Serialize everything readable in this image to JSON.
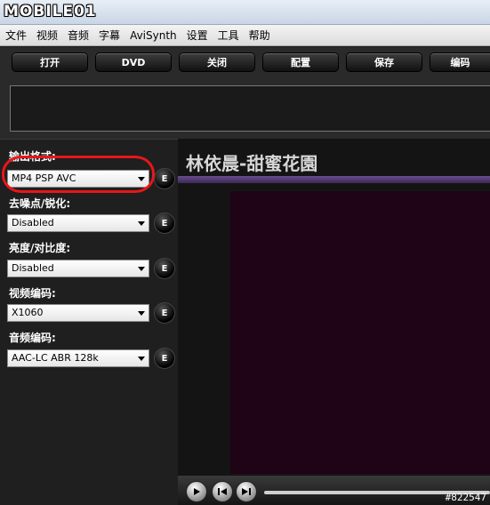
{
  "window": {
    "logo_text": "MOBILE01"
  },
  "menu": [
    "文件",
    "视频",
    "音频",
    "字幕",
    "AviSynth",
    "设置",
    "工具",
    "帮助"
  ],
  "toolbar": [
    "打开",
    "DVD",
    "关闭",
    "配置",
    "保存",
    "编码"
  ],
  "sidebar": {
    "fields": [
      {
        "label": "输出格式:",
        "value": "MP4 PSP AVC",
        "button": "E"
      },
      {
        "label": "去噪点/锐化:",
        "value": "Disabled",
        "button": "E"
      },
      {
        "label": "亮度/对比度:",
        "value": "Disabled",
        "button": "E"
      },
      {
        "label": "视频编码:",
        "value": "X1060",
        "button": "E"
      },
      {
        "label": "音频编码:",
        "value": "AAC-LC ABR 128k",
        "button": "E"
      }
    ]
  },
  "video": {
    "title": "林依晨-甜蜜花園"
  },
  "watermark": "#822547",
  "colors": {
    "highlight": "#e8161b",
    "accent_bar": "#6a4d8f",
    "video_bg": "#1e0416"
  }
}
